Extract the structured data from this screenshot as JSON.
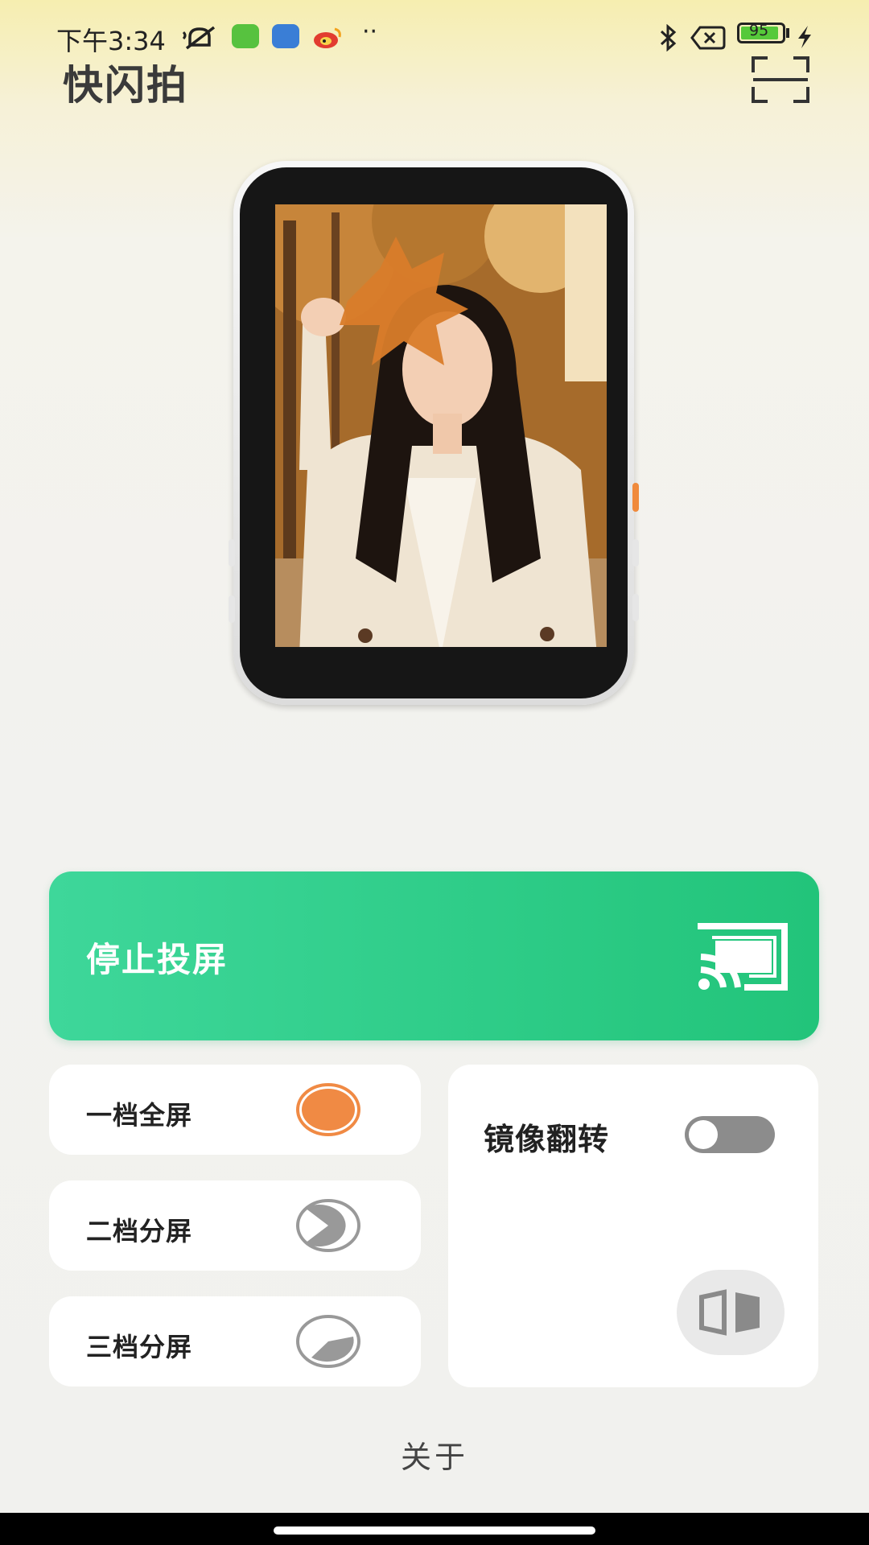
{
  "status_bar": {
    "time": "下午3:34",
    "more": "··",
    "battery": "95",
    "colors": {
      "battery_fill": "#56c93a",
      "chip_green": "#57c23f",
      "chip_blue": "#3a7ed6"
    }
  },
  "header": {
    "title": "快闪拍",
    "scan_icon": "scan-icon"
  },
  "device_preview": {
    "image_subject": "photo-of-woman-with-maple-leaf"
  },
  "cast": {
    "label": "停止投屏",
    "icon": "cast-icon",
    "color_start": "#3ed79a",
    "color_end": "#22c47a"
  },
  "modes": [
    {
      "label": "一档全屏",
      "indicator": "full-circle",
      "selected": true
    },
    {
      "label": "二档分屏",
      "indicator": "split-circle",
      "selected": false
    },
    {
      "label": "三档分屏",
      "indicator": "triple-split-circle",
      "selected": false
    }
  ],
  "mirror": {
    "label": "镜像翻转",
    "enabled": false,
    "icon": "mirror-flip-icon"
  },
  "footer": {
    "about": "关于"
  }
}
